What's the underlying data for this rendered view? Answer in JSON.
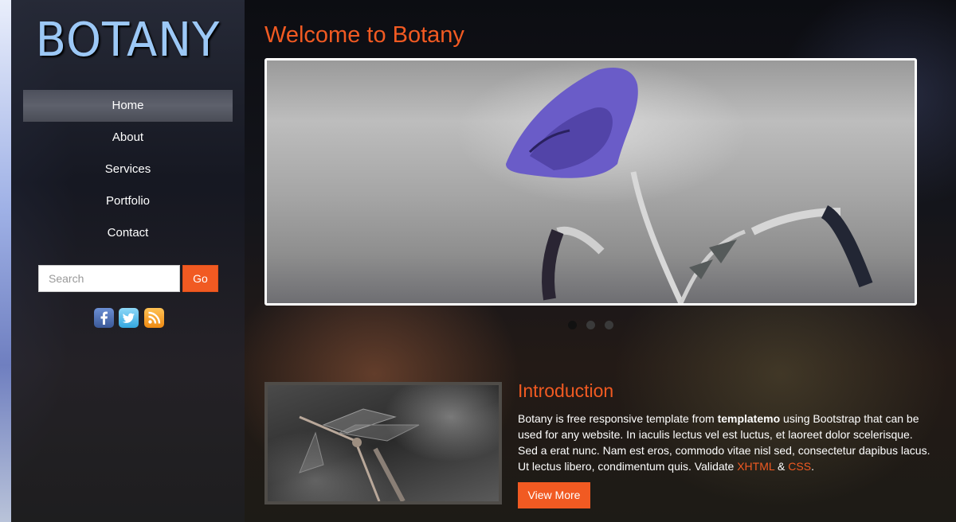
{
  "sidebar": {
    "logo": "BOTANY",
    "nav": [
      {
        "label": "Home",
        "active": true
      },
      {
        "label": "About",
        "active": false
      },
      {
        "label": "Services",
        "active": false
      },
      {
        "label": "Portfolio",
        "active": false
      },
      {
        "label": "Contact",
        "active": false
      }
    ],
    "search": {
      "placeholder": "Search",
      "button_label": "Go"
    },
    "social": [
      "facebook-icon",
      "twitter-icon",
      "rss-icon"
    ]
  },
  "main": {
    "title": "Welcome to Botany",
    "slider": {
      "slide_count": 3,
      "active_index": 0
    }
  },
  "intro": {
    "title": "Introduction",
    "text_before": "Botany is free responsive template from ",
    "brand": "templatemo",
    "text_after": " using Bootstrap that can be used for any website. In iaculis lectus vel est luctus, et laoreet dolor scelerisque. Sed a erat nunc. Nam est eros, commodo vitae nisl sed, consectetur dapibus lacus. Ut lectus libero, condimentum quis. Validate ",
    "xhtml_link": "XHTML",
    "amp": " & ",
    "css_link": "CSS",
    "period": ".",
    "button_label": "View More"
  },
  "colors": {
    "accent": "#f15a22",
    "logo": "#9cc8f6"
  }
}
